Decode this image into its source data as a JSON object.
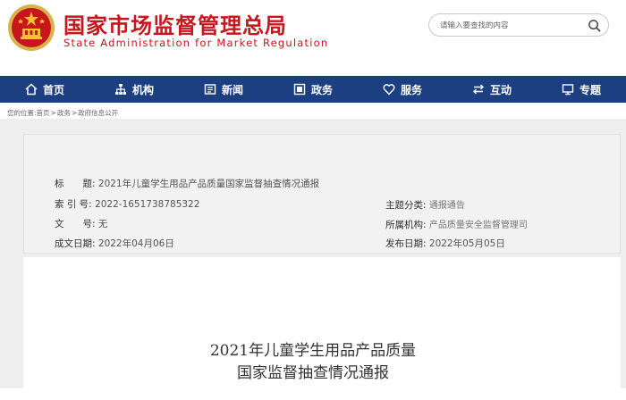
{
  "header": {
    "site_title": "国家市场监督管理总局",
    "site_subtitle": "State Administration for Market Regulation",
    "search_placeholder": "请输入要查找的内容",
    "colors": {
      "brand_red": "#c8161d",
      "nav_blue": "#1c3f82"
    }
  },
  "nav": {
    "items": [
      {
        "label": "首页",
        "icon": "home-icon"
      },
      {
        "label": "机构",
        "icon": "org-chart-icon"
      },
      {
        "label": "新闻",
        "icon": "newspaper-icon"
      },
      {
        "label": "政务",
        "icon": "government-icon"
      },
      {
        "label": "服务",
        "icon": "heart-icon"
      },
      {
        "label": "互动",
        "icon": "exchange-arrows-icon"
      },
      {
        "label": "专题",
        "icon": "topic-board-icon"
      }
    ]
  },
  "breadcrumb": [
    "您的位置:首页",
    "政务",
    "政府信息公开"
  ],
  "info": {
    "title_label": "标　　题:",
    "title_value": "2021年儿童学生用品产品质量国家监督抽查情况通报",
    "index_label": "索 引 号:",
    "index_value": "2022-1651738785322",
    "doc_no_label": "文　　号:",
    "doc_no_value": "无",
    "date_label": "成文日期:",
    "date_value": "2022年04月06日",
    "topic_label": "主题分类:",
    "topic_value": "通报通告",
    "org_label": "所属机构:",
    "org_value": "产品质量安全监督管理司",
    "pub_label": "发布日期:",
    "pub_value": "2022年05月05日"
  },
  "document": {
    "title_line1": "2021年儿童学生用品产品质量",
    "title_line2": "国家监督抽查情况通报"
  }
}
